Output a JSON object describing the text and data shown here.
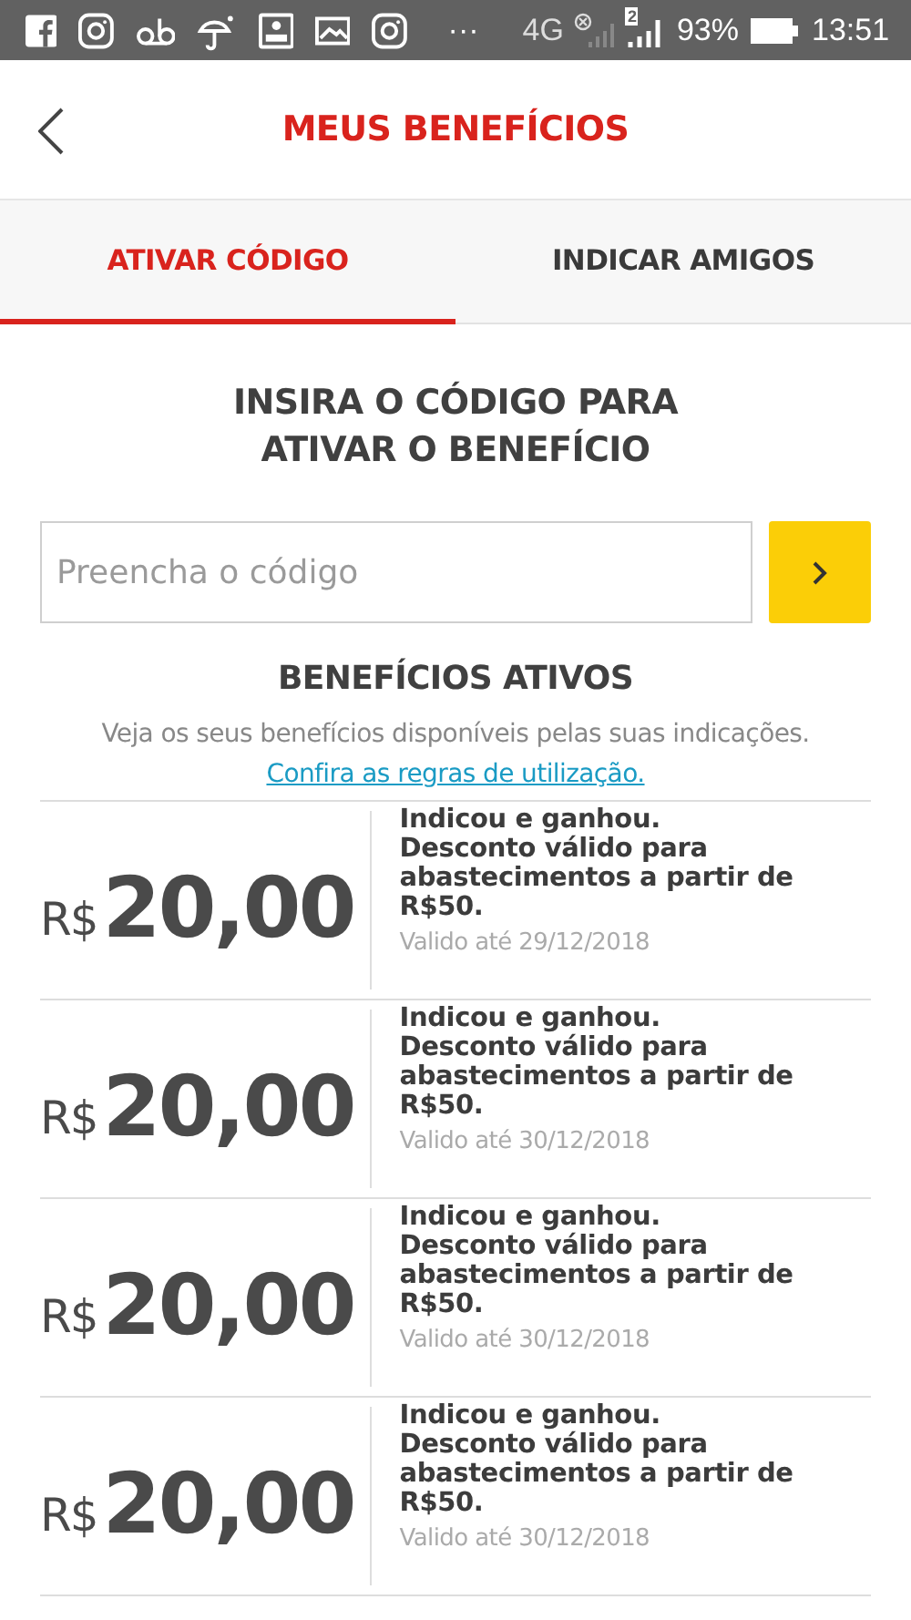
{
  "status_bar": {
    "more": "···",
    "network": "4G",
    "sim": "2",
    "battery": "93%",
    "time": "13:51"
  },
  "header": {
    "title": "MEUS BENEFÍCIOS"
  },
  "tabs": [
    {
      "label": "ATIVAR CÓDIGO",
      "selected": true
    },
    {
      "label": "INDICAR AMIGOS",
      "selected": false
    }
  ],
  "code_form": {
    "heading": "INSIRA O CÓDIGO PARA\nATIVAR O BENEFÍCIO",
    "placeholder": "Preencha o código"
  },
  "benefits": {
    "heading": "BENEFÍCIOS ATIVOS",
    "note": "Veja os seus benefícios disponíveis pelas suas indicações.",
    "link": "Confira as regras de utilização.",
    "items": [
      {
        "currency": "R$",
        "amount": "20,00",
        "description": "Indicou e ganhou.\nDesconto válido para abastecimentos a partir de R$50.",
        "validity": "Valido até 29/12/2018"
      },
      {
        "currency": "R$",
        "amount": "20,00",
        "description": "Indicou e ganhou.\nDesconto válido para abastecimentos a partir de R$50.",
        "validity": "Valido até 30/12/2018"
      },
      {
        "currency": "R$",
        "amount": "20,00",
        "description": "Indicou e ganhou.\nDesconto válido para abastecimentos a partir de R$50.",
        "validity": "Valido até 30/12/2018"
      },
      {
        "currency": "R$",
        "amount": "20,00",
        "description": "Indicou e ganhou.\nDesconto válido para abastecimentos a partir de R$50.",
        "validity": "Valido até 30/12/2018"
      }
    ]
  }
}
